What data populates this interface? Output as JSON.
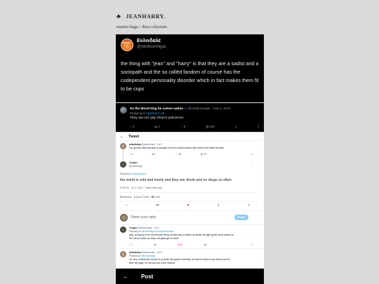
{
  "blog": {
    "title": "JEANHARRY.",
    "tags": "martin haga / disco elysium"
  },
  "quote_tweet": {
    "display_name": "Ενλινδαλέ",
    "handle": "@verekuningas",
    "avatar_label": "HANLAEG",
    "text": "the thing with \"jean\" and \"harry\" is that they are a sadist and a sociopath and the so callëd fandom of course has the codependent personality disorder which in fact makes them fit to be cops"
  },
  "reply_tweet": {
    "display_name": "So the blood king he comes nation",
    "handle_meta": "@verekuningas · Sep 2, 2024",
    "replying_prefix": "Replying to ",
    "replying_to": "@jimbeef_art",
    "text": "They are not 'gay' they're policemen",
    "counts": {
      "reply": "2",
      "retweet": "2",
      "like": "6",
      "views": "280"
    }
  },
  "thread": {
    "back_arrow": "←",
    "header": "Tweet",
    "first": {
      "name": "yekokotsa",
      "meta": "@yekokotsa · Jul 3",
      "text": "I've got this idea that jean is straight, but he's fooled around with harry a few times at least",
      "counts": {
        "reply": "8",
        "retweet": "1",
        "like": "38",
        "views": "2K"
      }
    },
    "main": {
      "name": "<Lugo>",
      "handle": "@marlinluga",
      "replying_prefix": "Replying to ",
      "replying_to": "@yekokotsa",
      "text": "the world is cold and lonely and they are drunk and on drugs so often",
      "timestamp": "5:05 PM · Jul 3, 2023 · Twitter Web App",
      "stats": [
        {
          "num": "3",
          "label": "Retweets"
        },
        {
          "num": "1",
          "label": "Quote Tweet"
        },
        {
          "num": "28",
          "label": "Likes"
        }
      ]
    },
    "reply_placeholder": "Tweet your reply",
    "reply_button": "Reply",
    "second": {
      "name": "<Lugo>",
      "meta": "@marlinluga · Jul 3",
      "replying_prefix": "Replying to ",
      "replying_to": "@marlinluga and @yekokotsa",
      "text1": "jean: (rising up from bed beside harry) lol that was a fucked up dream all right (pulls some speed on",
      "text2": "the mirror) wake up harry, we gotta get to work!",
      "counts": {
        "reply": "1",
        "retweet": "",
        "like": "10",
        "views": ""
      }
    },
    "third": {
      "name": "yekokotsa",
      "meta": "@yekokotsa · Jul 3",
      "replying_prefix": "Replying to ",
      "replying_to": "@marlinluga",
      "text1": "it's very considerate of jean to provide the speed, honestly. he doesn't need to ask harry how he",
      "text2": "likes his eggs, he can just cut a line instead"
    }
  },
  "bottom_bar": {
    "back_arrow": "←",
    "title": "Post"
  },
  "icons": {
    "spade": "♣"
  }
}
